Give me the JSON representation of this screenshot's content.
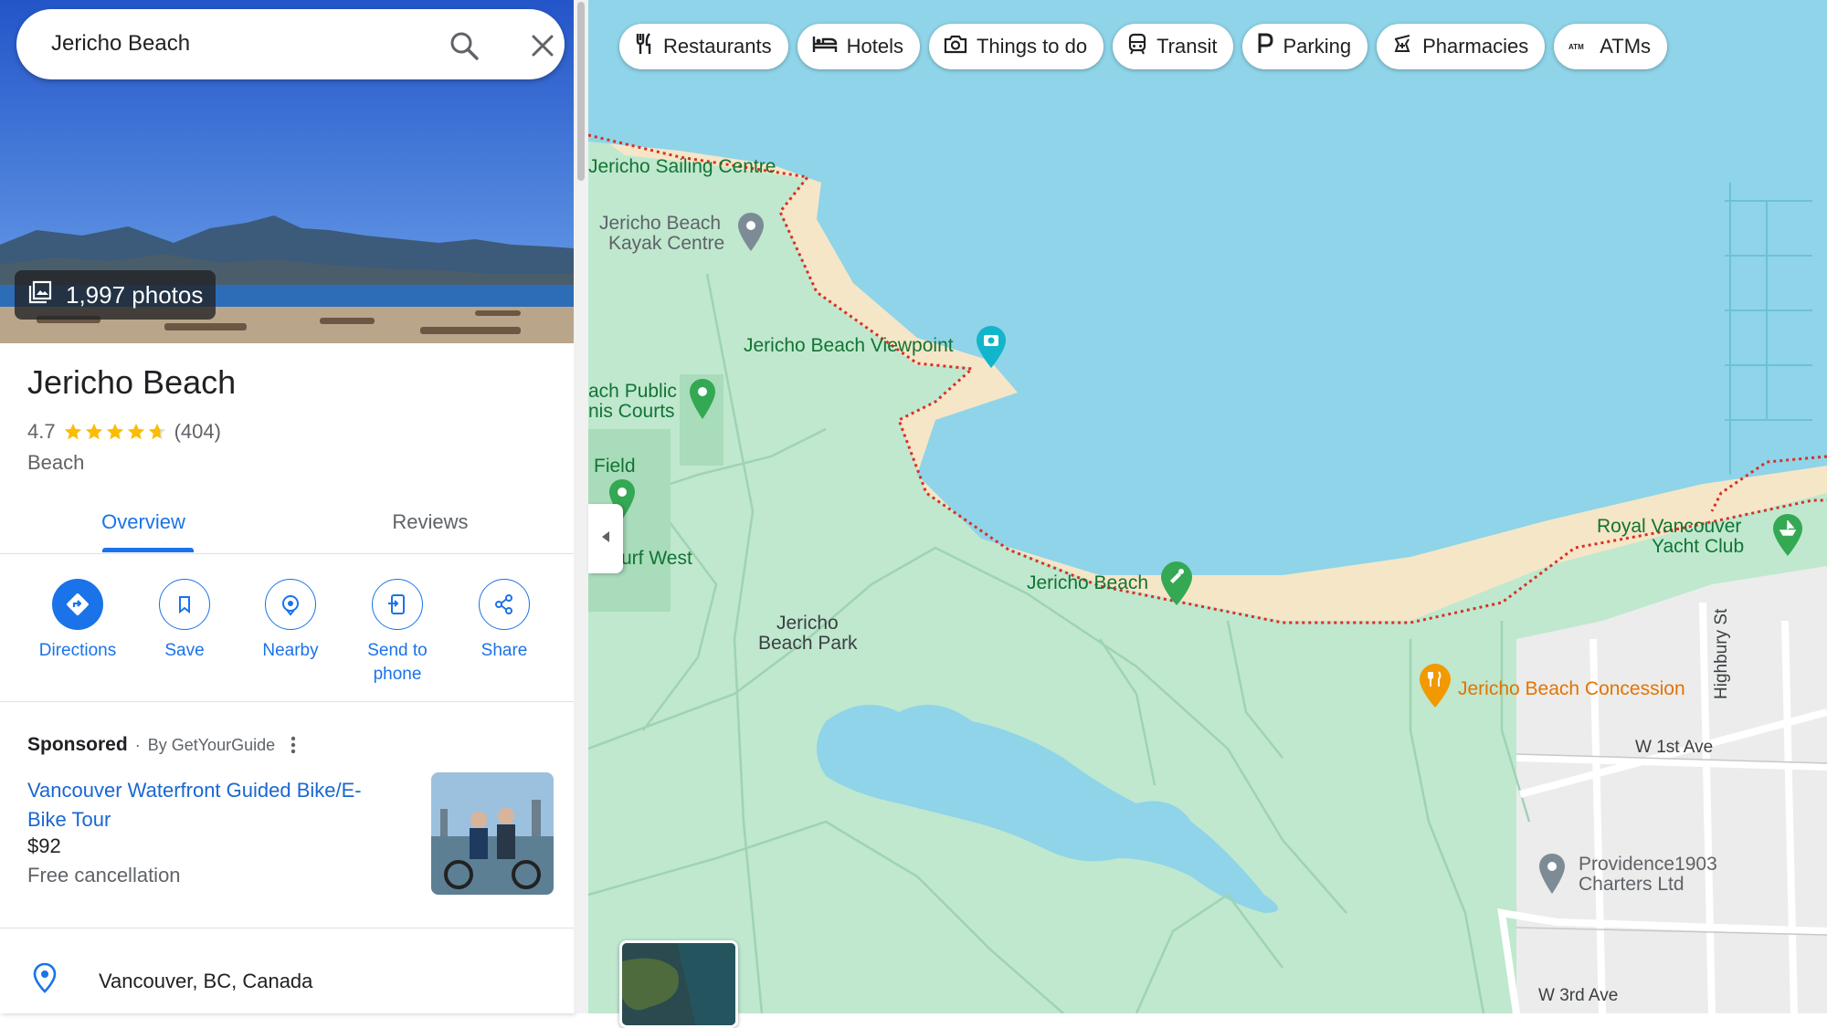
{
  "search": {
    "value": "Jericho Beach"
  },
  "hero": {
    "photos_count": "1,997 photos"
  },
  "place": {
    "title": "Jericho Beach",
    "rating": "4.7",
    "stars": 4.7,
    "reviews_count": "(404)",
    "category": "Beach"
  },
  "tabs": [
    {
      "label": "Overview",
      "active": true
    },
    {
      "label": "Reviews",
      "active": false
    }
  ],
  "actions": [
    {
      "label": "Directions",
      "icon": "directions-icon"
    },
    {
      "label": "Save",
      "icon": "bookmark-icon"
    },
    {
      "label": "Nearby",
      "icon": "nearby-icon"
    },
    {
      "label": "Send to phone",
      "icon": "send-to-phone-icon"
    },
    {
      "label": "Share",
      "icon": "share-icon"
    }
  ],
  "sponsored": {
    "label": "Sponsored",
    "by": "By GetYourGuide",
    "ad_title": "Vancouver Waterfront Guided Bike/E-Bike Tour",
    "price": "$92",
    "note": "Free cancellation"
  },
  "address": "Vancouver, BC, Canada",
  "chips": [
    {
      "label": "Restaurants",
      "icon": "restaurant-icon"
    },
    {
      "label": "Hotels",
      "icon": "hotel-icon"
    },
    {
      "label": "Things to do",
      "icon": "camera-icon"
    },
    {
      "label": "Transit",
      "icon": "transit-icon"
    },
    {
      "label": "Parking",
      "icon": "parking-icon"
    },
    {
      "label": "Pharmacies",
      "icon": "pharmacy-icon"
    },
    {
      "label": "ATMs",
      "icon": "atm-icon"
    }
  ],
  "map": {
    "labels": {
      "sailing_centre": "Jericho Sailing Centre",
      "kayak_1": "Jericho Beach",
      "kayak_2": "Kayak Centre",
      "viewpoint": "Jericho Beach Viewpoint",
      "tennis_1": "ach Public",
      "tennis_2": "nis Courts",
      "field": "Field",
      "turf": "urf West",
      "park_1": "Jericho",
      "park_2": "Beach Park",
      "beach": "Jericho Beach",
      "yacht_1": "Royal Vancouver",
      "yacht_2": "Yacht Club",
      "concession": "Jericho Beach Concession",
      "providence_1": "Providence1903",
      "providence_2": "Charters Ltd",
      "w1st": "W 1st Ave",
      "w3rd": "W 3rd Ave",
      "highbury": "Highbury St"
    },
    "colors": {
      "water": "#8fd4e8",
      "park": "#bfe8cf",
      "beach": "#f5e6c8",
      "urban": "#ececec",
      "boundary": "#d93025"
    }
  }
}
